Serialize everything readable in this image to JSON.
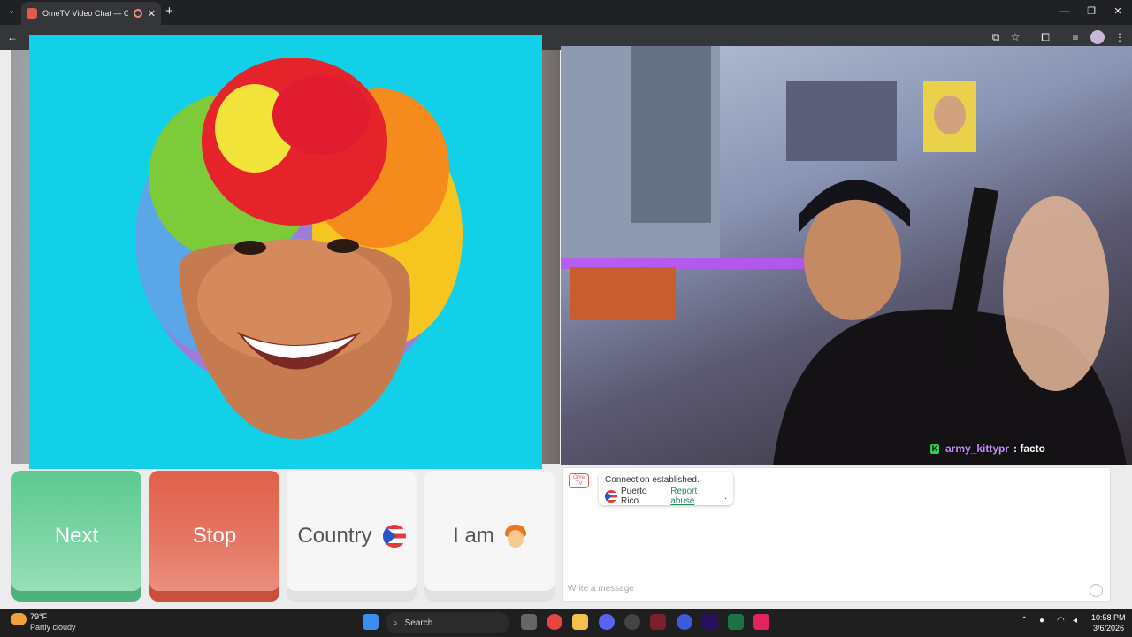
{
  "browser": {
    "tab_title": "OmeTV Video Chat — Ome",
    "tab_close": "✕",
    "new_tab": "+",
    "minimize": "—",
    "maximize": "❐",
    "close": "✕"
  },
  "buttons": {
    "next_label": "Next",
    "stop_label": "Stop",
    "country_label": "Country",
    "iam_label": "I am"
  },
  "stream_overlay": {
    "badge": "K",
    "username": "army_kittypr",
    "message": ": facto"
  },
  "chat": {
    "logo_text": "Ome TV",
    "connection_text": "Connection established.",
    "country_text": "Puerto Rico.",
    "report_link": "Report abuse",
    "report_suffix": ".",
    "input_placeholder": "Write a message"
  },
  "taskbar": {
    "temperature": "79°F",
    "weather": "Partly cloudy",
    "search_label": "Search",
    "time": "10:58 PM",
    "date": "3/6/2026"
  },
  "colors": {
    "next": "#5cc98f",
    "stop": "#e0604a",
    "left_camera_bg": "#12d0e8"
  }
}
